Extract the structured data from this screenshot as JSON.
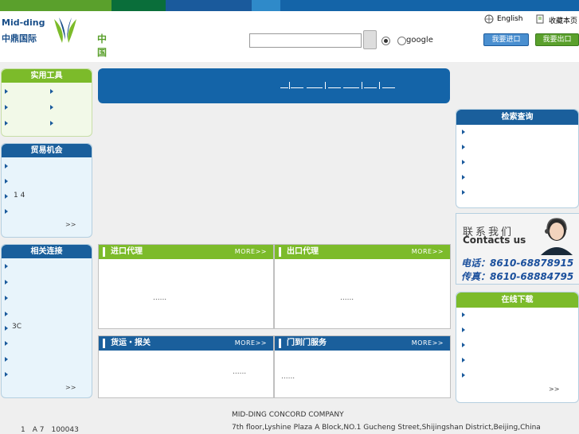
{
  "colors": {
    "topbar": [
      "#5aa02c",
      "#0a6e3a",
      "#1a5a9c",
      "#2f8ac9",
      "#1464a8"
    ],
    "blue": "#1464a8",
    "green": "#7cbb2a",
    "dark_blue_head": "#1a5f9c"
  },
  "header": {
    "logo_en": "Mid-ding",
    "logo_cn": "中鼎国际",
    "logo_cn2": "中 国",
    "logo_mark_icon": "leaf-logo-icon",
    "search_value": "",
    "radio_option_label": "google",
    "english_label": "English",
    "favorite_label": "收藏本页",
    "btn_import": "我要进口",
    "btn_export": "我要出口"
  },
  "left": {
    "tools": {
      "title": "实用工具",
      "more": ""
    },
    "trade": {
      "title": "贸易机会",
      "item3": "1 4",
      "more": ">>"
    },
    "links": {
      "title": "相关连接",
      "item5": "3C",
      "more": ">>"
    }
  },
  "center": {
    "import": {
      "title": "进口代理",
      "more": "MORE>>",
      "body": "......"
    },
    "export": {
      "title": "出口代理",
      "more": "MORE>>",
      "body": "......"
    },
    "freight": {
      "title": "货运・报关",
      "more": "MORE>>",
      "body": "......"
    },
    "door": {
      "title": "门到门服务",
      "more": "MORE>>",
      "body": "......"
    }
  },
  "right": {
    "search": {
      "title": "检索查询"
    },
    "contact": {
      "cn": "联系我们",
      "en": "Contacts us",
      "tel": "电话：8610-68878915",
      "fax": "传真：8610-68884795"
    },
    "download": {
      "title": "在线下载",
      "more": ">>"
    }
  },
  "footer": {
    "left": "1　A 7　100043",
    "company": "MID-DING CONCORD COMPANY",
    "address": "7th floor,Lyshine Plaza A Block,NO.1 Gucheng Street,Shijingshan District,Beijing,China"
  }
}
